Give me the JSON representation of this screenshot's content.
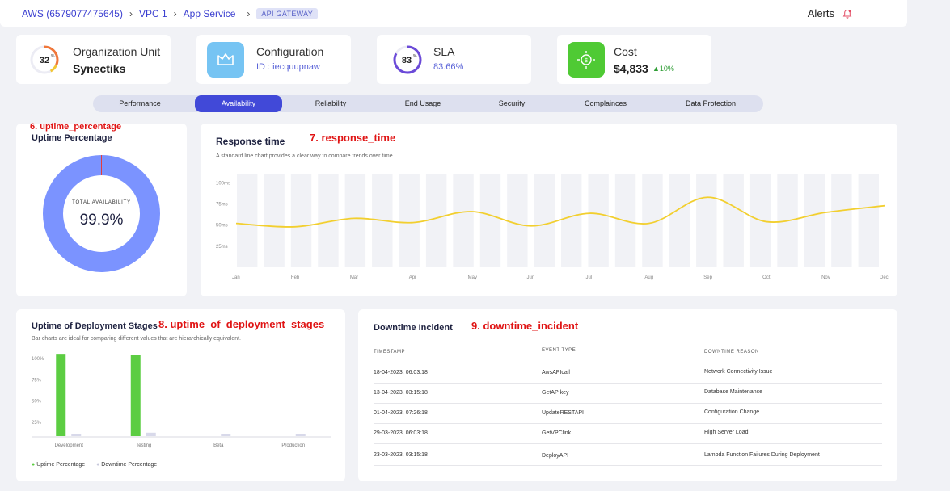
{
  "breadcrumb": {
    "items": [
      "AWS (6579077475645)",
      "VPC 1",
      "App Service"
    ],
    "current": "API GATEWAY"
  },
  "alerts": {
    "label": "Alerts",
    "icon": "bell-icon"
  },
  "kpis": {
    "org": {
      "ring_value": "32",
      "ring_unit": "%",
      "title": "Organization Unit",
      "value": "Synectiks"
    },
    "config": {
      "title": "Configuration",
      "id_label": "ID : iecquupnaw",
      "icon": "crown-icon"
    },
    "sla": {
      "ring_value": "83",
      "ring_unit": "%",
      "title": "SLA",
      "value": "83.66%"
    },
    "cost": {
      "title": "Cost",
      "value": "$4,833",
      "change": "10%",
      "icon": "dollar-icon"
    }
  },
  "tabs": [
    "Performance",
    "Availability",
    "Reliability",
    "End Usage",
    "Security",
    "Complainces",
    "Data Protection"
  ],
  "active_tab": "Availability",
  "uptime": {
    "annotation": "6. uptime_percentage",
    "title": "Uptime Percentage",
    "center_label": "TOTAL AVAILABILITY",
    "center_value": "99.9%",
    "availability_fraction": 0.999,
    "color": "#7b93ff"
  },
  "response": {
    "annotation": "7. response_time",
    "title": "Response time",
    "caption": "A standard line chart provides a clear way to compare trends over time."
  },
  "deploy": {
    "annotation": "8. uptime_of_deployment_stages",
    "title": "Uptime of Deployment Stages",
    "caption": "Bar charts are ideal for comparing different values that are hierarchically equivalent.",
    "legend": [
      "Uptime Percentage",
      "Downtime Percentage"
    ]
  },
  "downtime": {
    "annotation": "9. downtime_incident",
    "title": "Downtime Incident",
    "headers": [
      "TIMESTAMP",
      "EVENT TYPE",
      "DOWNTIME REASON"
    ],
    "rows": [
      [
        "18-04-2023, 06:03:18",
        "AwsAPIcall",
        "Network Connectivity Issue"
      ],
      [
        "13-04-2023, 03:15:18",
        "GetAPIkey",
        "Database Maintenance"
      ],
      [
        "01-04-2023, 07:26:18",
        "UpdateRESTAPI",
        "Configuration Change"
      ],
      [
        "29-03-2023, 06:03:18",
        "GetVPClink",
        "High Server Load"
      ],
      [
        "23-03-2023, 03:15:18",
        "DeployAPI",
        "Lambda Function Failures During Deployment"
      ]
    ]
  },
  "chart_data": [
    {
      "type": "line",
      "title": "Response time",
      "categories": [
        "Jan",
        "Feb",
        "Mar",
        "Apr",
        "May",
        "Jun",
        "Jul",
        "Aug",
        "Sep",
        "Oct",
        "Nov",
        "Dec"
      ],
      "y_ticks": [
        "100ms",
        "75ms",
        "50ms",
        "25ms"
      ],
      "ylim": [
        0,
        110
      ],
      "series": [
        {
          "values": [
            52,
            48,
            58,
            53,
            66,
            49,
            64,
            52,
            83,
            54,
            65,
            73
          ],
          "color": "#f2cf2f"
        }
      ],
      "grid": true
    },
    {
      "type": "bar",
      "title": "Uptime of Deployment Stages",
      "categories": [
        "Development",
        "Testing",
        "Beta",
        "Production"
      ],
      "y_ticks": [
        "100%",
        "75%",
        "50%",
        "25%"
      ],
      "ylim": [
        0,
        100
      ],
      "series": [
        {
          "name": "Uptime Percentage",
          "values": [
            97,
            96,
            0,
            0
          ],
          "color": "#5ccd42"
        },
        {
          "name": "Downtime Percentage",
          "values": [
            2,
            4,
            2,
            2
          ],
          "color": "#d8d9ea"
        }
      ]
    }
  ]
}
